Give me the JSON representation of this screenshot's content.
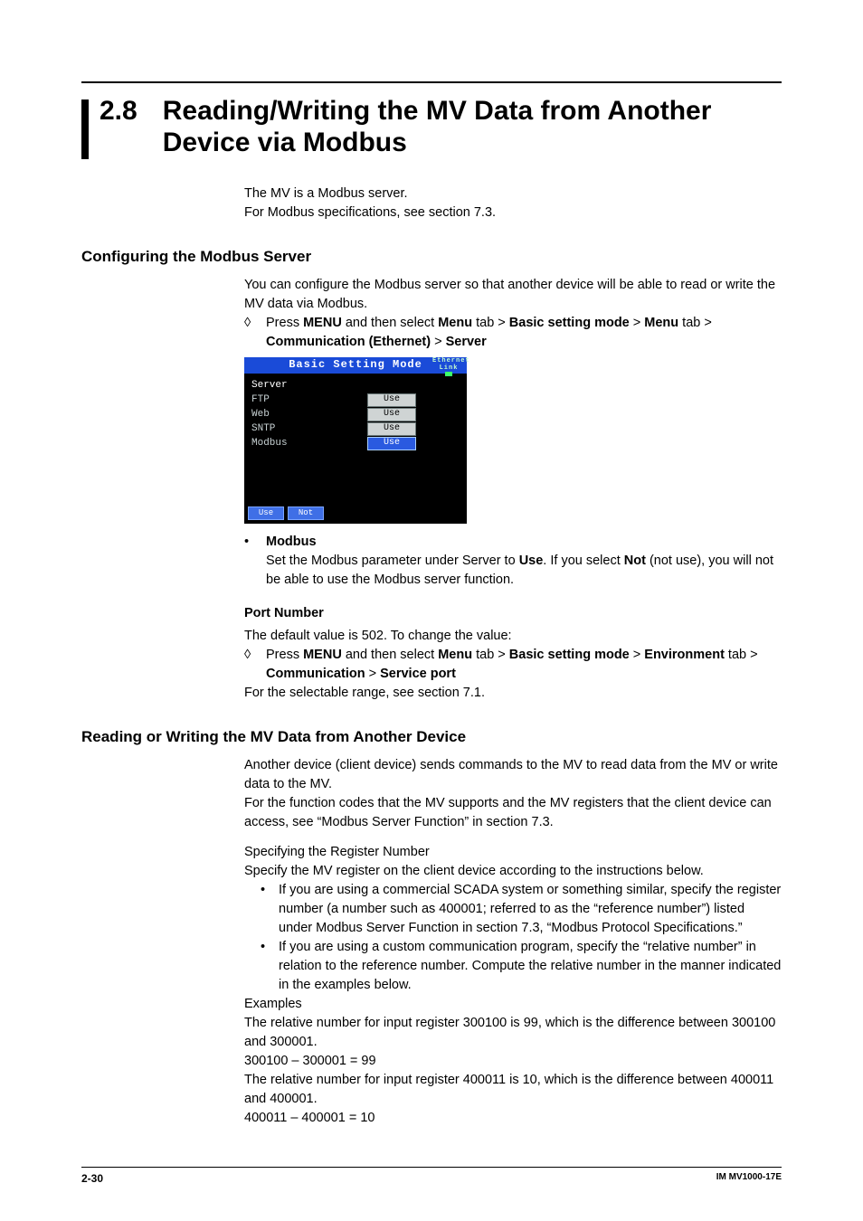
{
  "section_number": "2.8",
  "section_title": "Reading/Writing the MV Data from Another Device via Modbus",
  "intro_line1": "The MV is a Modbus server.",
  "intro_line2": "For Modbus specifications, see section 7.3.",
  "h2_config": "Configuring the Modbus Server",
  "config_desc": "You can configure the Modbus server so that another device will be able to read or write the MV data via Modbus.",
  "diamond": "◊",
  "nav1_pre": "Press ",
  "nav1_menu": "MENU",
  "nav1_mid": " and then select ",
  "nav1_menu2": "Menu",
  "nav1_tab": " tab > ",
  "nav1_bsm": "Basic setting mode",
  "nav1_gt": " > ",
  "nav1_menu3": "Menu",
  "nav1_tab2": " tab > ",
  "nav1_comm": "Communication (Ethernet)",
  "nav1_server": "Server",
  "screenshot": {
    "title": "Basic Setting Mode",
    "link_label": "Ethernet\nLink",
    "section": "Server",
    "rows": [
      {
        "label": "FTP",
        "value": "Use",
        "selected": false
      },
      {
        "label": "Web",
        "value": "Use",
        "selected": false
      },
      {
        "label": "SNTP",
        "value": "Use",
        "selected": false
      },
      {
        "label": "Modbus",
        "value": "Use",
        "selected": true
      }
    ],
    "toggle_use": "Use",
    "toggle_not": "Not"
  },
  "bullet_dot": "•",
  "modbus_bullet_title": "Modbus",
  "modbus_bullet_a": "Set the Modbus parameter under Server to ",
  "modbus_bullet_use": "Use",
  "modbus_bullet_b": ". If you select ",
  "modbus_bullet_not": "Not",
  "modbus_bullet_c": " (not use), you will not be able to use the Modbus server function.",
  "h3_port": "Port Number",
  "port_default": "The default value is 502. To change the value:",
  "nav2_env": "Environment",
  "nav2_comm": "Communication",
  "nav2_sp": "Service port",
  "port_range": "For the selectable range, see section 7.1.",
  "h2_rw": "Reading or Writing the MV Data from Another Device",
  "rw_p1": "Another device (client device) sends commands to the MV to read data from the MV or write data to the MV.",
  "rw_p2": "For the function codes that the MV supports and the MV registers that the client device can access, see “Modbus Server Function” in section 7.3.",
  "rw_spec_title": "Specifying the Register Number",
  "rw_spec_desc": "Specify the MV register on the client device according to the instructions below.",
  "rw_li1": "If you are using a commercial SCADA system or something similar, specify the register number (a number such as 400001; referred to as the “reference number”) listed under Modbus Server Function in section 7.3, “Modbus Protocol Specifications.”",
  "rw_li2": "If you are using a custom communication program, specify the “relative number” in relation to the reference number. Compute the relative number in the manner indicated in the examples below.",
  "ex_title": "Examples",
  "ex_l1": "The relative number for input register 300100 is 99, which is the difference between 300100 and 300001.",
  "ex_eq1": "300100 – 300001 = 99",
  "ex_l2": "The relative number for input register 400011 is 10, which is the difference between 400011 and 400001.",
  "ex_eq2": "400011 – 400001 = 10",
  "footer_page": "2-30",
  "footer_doc": "IM MV1000-17E"
}
